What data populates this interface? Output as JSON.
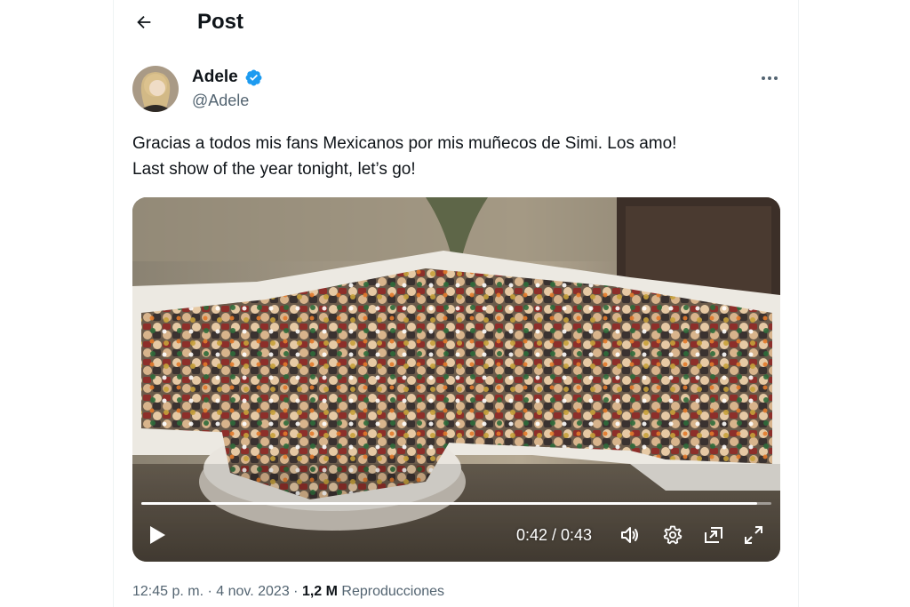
{
  "header": {
    "title": "Post",
    "back_icon": "arrow-left-icon"
  },
  "author": {
    "name": "Adele",
    "handle": "@Adele",
    "verified": true,
    "verified_color": "#1d9bf0"
  },
  "post": {
    "text_line1": "Gracias a todos mis fans Mexicanos por mis muñecos de Simi. Los amo!",
    "text_line2": "Last show of the year tonight, let’s go!"
  },
  "video": {
    "current_time": "0:42",
    "duration": "0:43",
    "time_display": "0:42 / 0:43",
    "progress": 0.977,
    "controls": [
      "play-icon",
      "volume-icon",
      "settings-icon",
      "picture-in-picture-icon",
      "fullscreen-icon"
    ]
  },
  "meta": {
    "time": "12:45 p. m.",
    "separator": "·",
    "date": "4 nov. 2023",
    "views_count": "1,2 M",
    "views_label": "Reproducciones"
  },
  "colors": {
    "text": "#0f1419",
    "secondary": "#536471",
    "accent": "#1d9bf0"
  }
}
